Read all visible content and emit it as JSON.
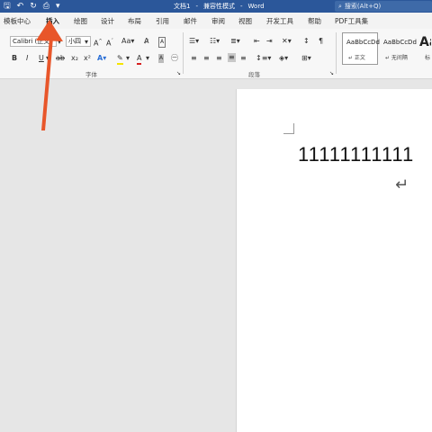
{
  "titlebar": {
    "title": "文档1",
    "mode": "兼容性模式",
    "app": "Word",
    "search_placeholder": "搜索(Alt+Q)",
    "qat": [
      "save-icon",
      "undo-icon",
      "redo-icon",
      "print-preview-icon"
    ],
    "bg_color": "#2b579a"
  },
  "tabs": [
    "模板中心",
    "插入",
    "绘图",
    "设计",
    "布局",
    "引用",
    "邮件",
    "审阅",
    "视图",
    "开发工具",
    "帮助",
    "PDF工具集"
  ],
  "active_tab": "插入",
  "ribbon": {
    "font_name": "Calibri (正文",
    "font_size": "小四",
    "group_font_label": "字体",
    "group_paragraph_label": "段落",
    "styles": [
      {
        "sample": "AaBbCcDd",
        "name": "↵ 正文"
      },
      {
        "sample": "AaBbCcDd",
        "name": "↵ 无间隔"
      },
      {
        "sample": "Aa",
        "name": "标"
      }
    ]
  },
  "document": {
    "text": "11111111111",
    "paragraph_mark": "↵"
  },
  "annotation": {
    "arrow_color": "#e8562a"
  }
}
